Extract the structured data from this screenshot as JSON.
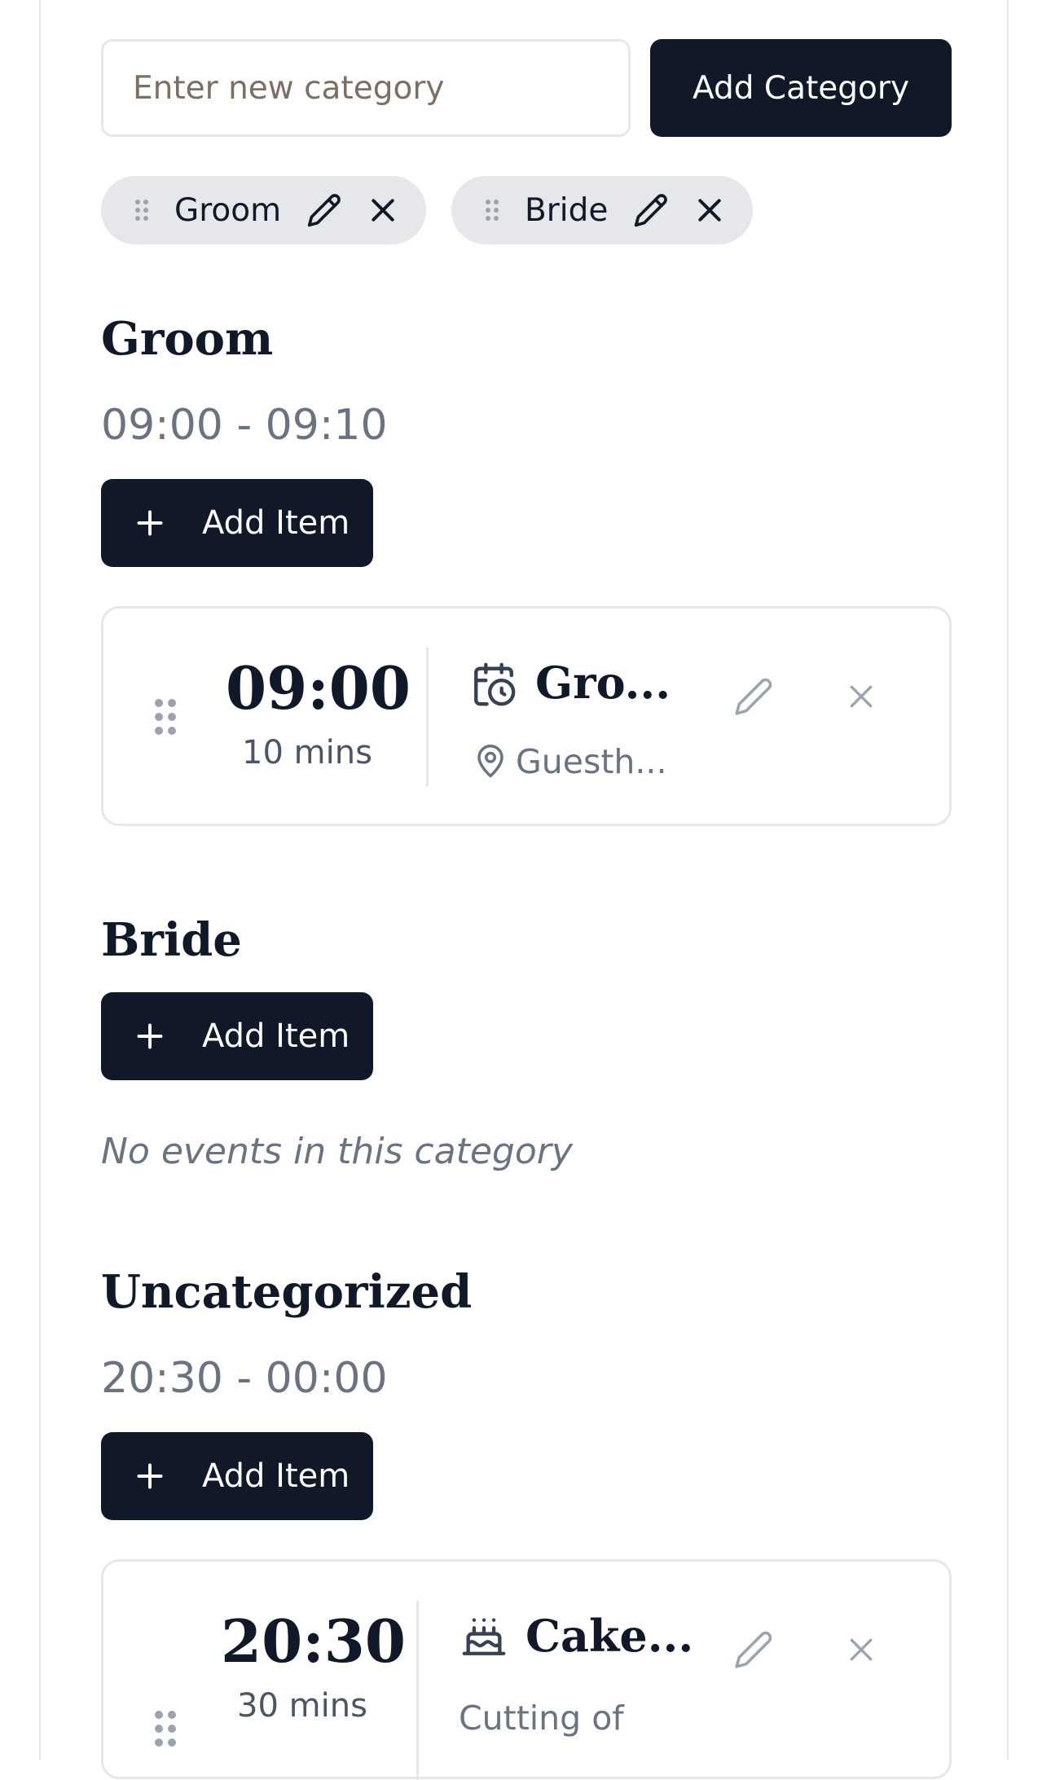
{
  "category_form": {
    "placeholder": "Enter new category",
    "value": "",
    "add_label": "Add Category"
  },
  "chips": [
    {
      "label": "Groom"
    },
    {
      "label": "Bride"
    }
  ],
  "sections": [
    {
      "title": "Groom",
      "range": "09:00 - 09:10",
      "add_label": "Add Item",
      "events": [
        {
          "time": "09:00",
          "duration": "10 mins",
          "title": "Gro...",
          "location": "Guesth...",
          "icon": "calendar-clock-icon"
        }
      ]
    },
    {
      "title": "Bride",
      "add_label": "Add Item",
      "empty_text": "No events in this category"
    },
    {
      "title": "Uncategorized",
      "range": "20:30 - 00:00",
      "add_label": "Add Item",
      "events": [
        {
          "time": "20:30",
          "duration": "30 mins",
          "title": "Cake...",
          "description": "Cutting of",
          "icon": "cake-icon"
        }
      ]
    }
  ],
  "colors": {
    "primary": "#111827",
    "muted_text": "#6b7280",
    "border": "#e5e7eb",
    "chip_bg": "#e5e7eb"
  }
}
